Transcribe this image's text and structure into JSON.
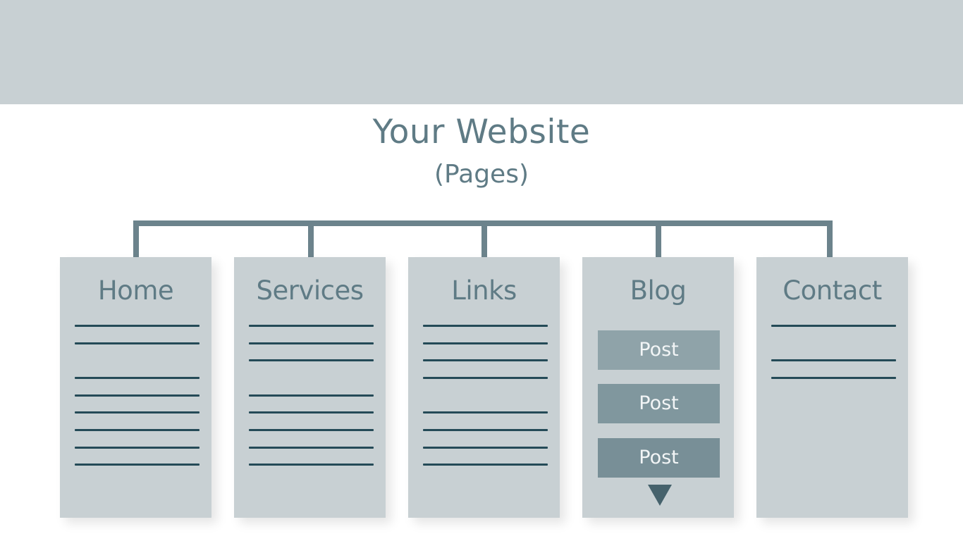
{
  "diagram": {
    "title": "Your Website",
    "subtitle": "(Pages)",
    "colors": {
      "banner": "#c8d0d3",
      "card": "#c8d0d3",
      "text": "#5f7b85",
      "connector": "#6c838c",
      "line": "#244a57",
      "post_shades": [
        "#8fa3a9",
        "#80979e",
        "#788f97"
      ],
      "arrow": "#46626c"
    },
    "pages": [
      {
        "label": "Home",
        "line_groups": [
          2,
          6
        ]
      },
      {
        "label": "Services",
        "line_groups": [
          3,
          5
        ]
      },
      {
        "label": "Links",
        "line_groups": [
          4,
          4
        ]
      },
      {
        "label": "Blog",
        "posts": [
          "Post",
          "Post",
          "Post"
        ],
        "more_indicator": "down-triangle"
      },
      {
        "label": "Contact",
        "line_groups": [
          1,
          2
        ]
      }
    ]
  }
}
